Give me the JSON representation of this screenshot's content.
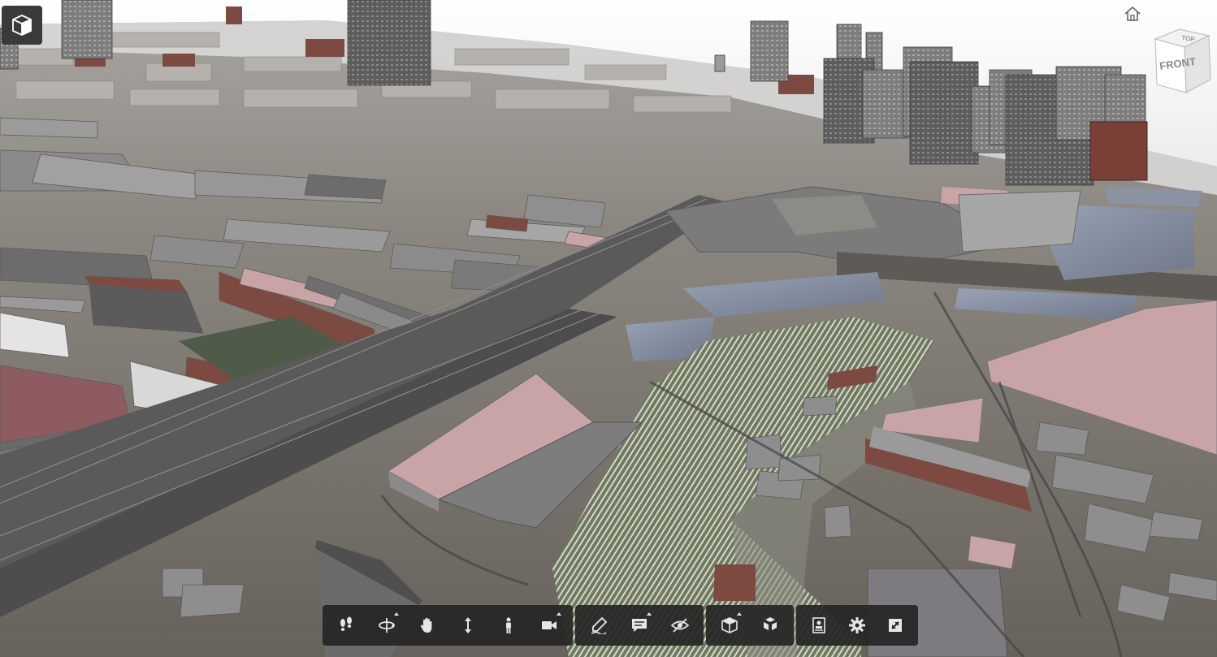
{
  "viewer": {
    "viewcube": {
      "top_label": "TOP",
      "front_label": "FRONT"
    }
  },
  "toolbar": {
    "groups": [
      {
        "name": "navigation",
        "tools": [
          "first-person",
          "orbit",
          "pan",
          "zoom",
          "walk",
          "camera"
        ]
      },
      {
        "name": "review",
        "tools": [
          "markup",
          "comment",
          "hide"
        ]
      },
      {
        "name": "model",
        "tools": [
          "section",
          "explode"
        ]
      },
      {
        "name": "settings",
        "tools": [
          "properties",
          "settings",
          "fullscreen"
        ]
      }
    ]
  },
  "colors": {
    "toolbar_bg": "#262626",
    "icon": "#e6e6e6",
    "sky": "#f3f3f3",
    "ground": "#7b7670",
    "building_gray": "#8e8e8e",
    "building_pink": "#c9a4a6",
    "building_brick": "#7c4a40",
    "water": "#7f8696"
  }
}
